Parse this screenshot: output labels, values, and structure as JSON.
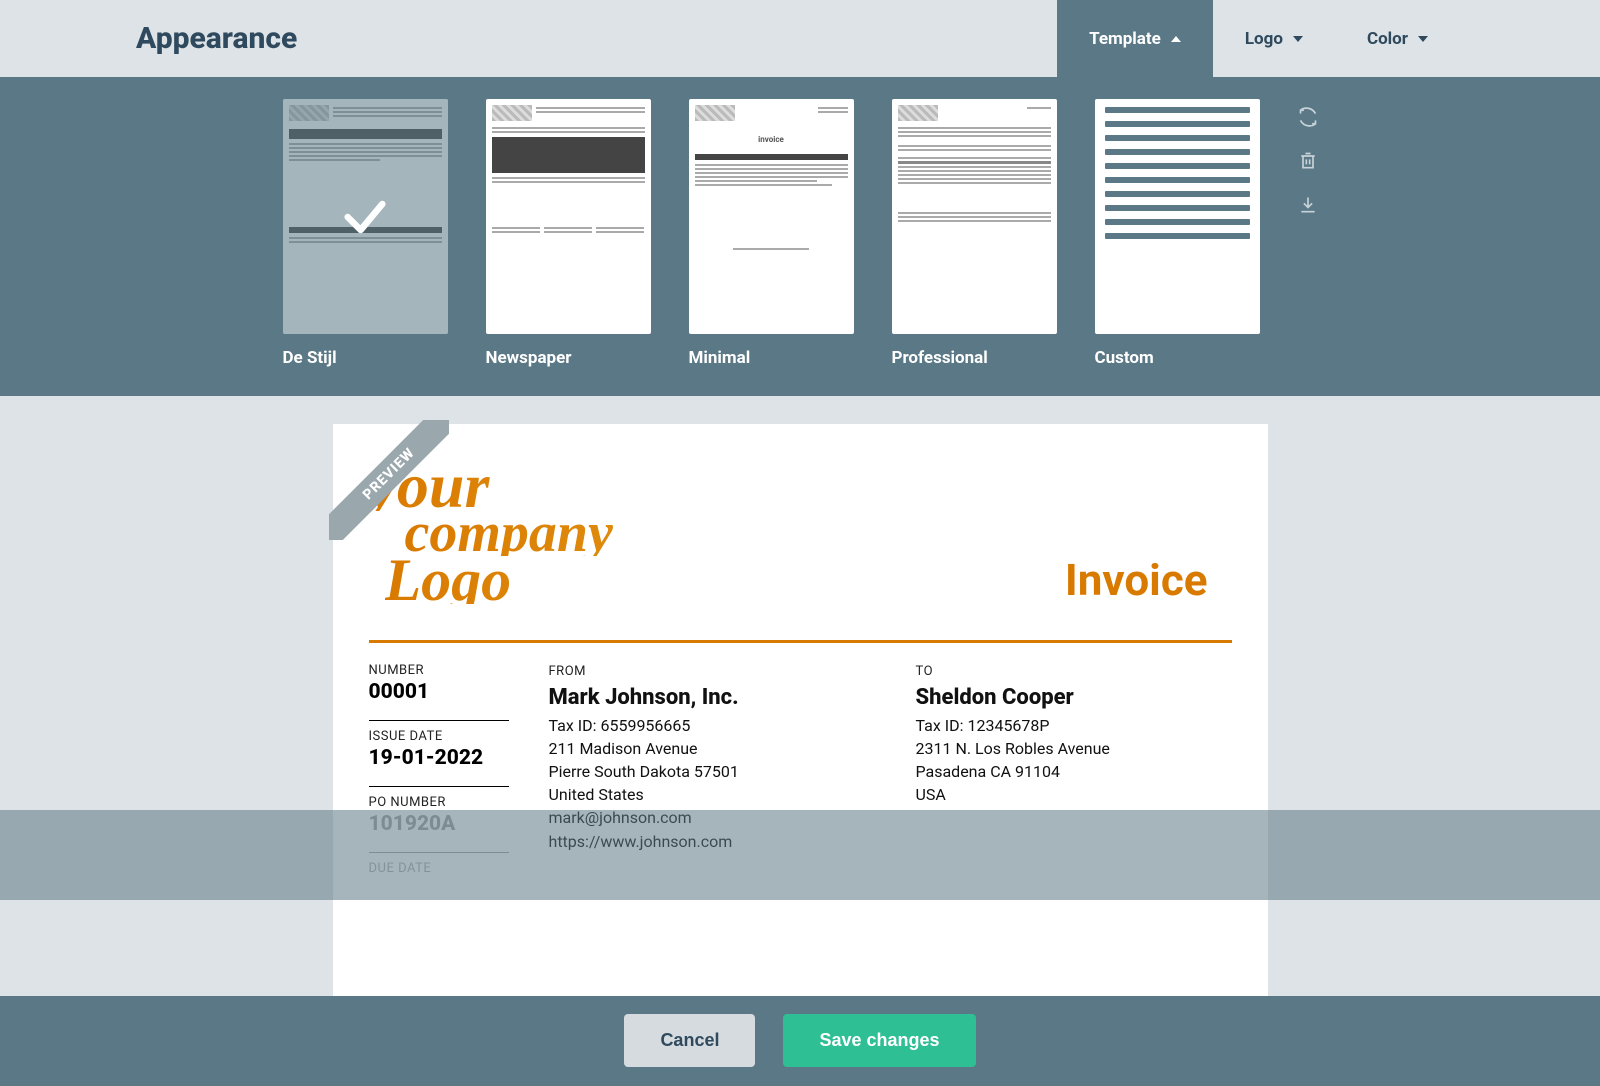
{
  "header": {
    "title": "Appearance",
    "tabs": [
      {
        "label": "Template",
        "active": true,
        "caret": "up"
      },
      {
        "label": "Logo",
        "active": false,
        "caret": "down"
      },
      {
        "label": "Color",
        "active": false,
        "caret": "down"
      }
    ]
  },
  "templates": [
    {
      "name": "De Stijl",
      "selected": true
    },
    {
      "name": "Newspaper",
      "selected": false
    },
    {
      "name": "Minimal",
      "selected": false
    },
    {
      "name": "Professional",
      "selected": false
    },
    {
      "name": "Custom",
      "selected": false
    }
  ],
  "side_actions": [
    "replace",
    "trash",
    "download"
  ],
  "preview": {
    "ribbon": "PREVIEW",
    "logo_lines": {
      "l1": "your",
      "l2": "company",
      "l3": "Logo"
    },
    "doc_title": "Invoice",
    "fields": {
      "number_label": "NUMBER",
      "number": "00001",
      "issue_label": "ISSUE DATE",
      "issue_date": "19-01-2022",
      "po_label": "PO NUMBER",
      "po_number": "101920A",
      "due_label": "DUE DATE"
    },
    "from": {
      "label": "FROM",
      "name": "Mark Johnson, Inc.",
      "tax": "Tax ID: 6559956665",
      "addr1": "211 Madison Avenue",
      "addr2": "Pierre South Dakota 57501",
      "country": "United States",
      "email": "mark@johnson.com",
      "web": "https://www.johnson.com"
    },
    "to": {
      "label": "TO",
      "name": "Sheldon Cooper",
      "tax": "Tax ID: 12345678P",
      "addr1": "2311 N. Los Robles Avenue",
      "addr2": "Pasadena CA 91104",
      "country": "USA"
    }
  },
  "footer": {
    "cancel": "Cancel",
    "save": "Save changes"
  },
  "colors": {
    "accent": "#d97a00",
    "brand": "#5a7885",
    "save": "#2ebf94"
  }
}
